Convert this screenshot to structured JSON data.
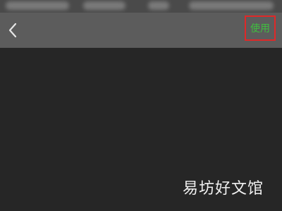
{
  "nav": {
    "back_icon": "chevron-left-icon",
    "use_label": "使用",
    "use_color": "#3fbf3f",
    "highlight_color": "#e02828"
  },
  "watermark": {
    "text": "易坊好文馆"
  }
}
